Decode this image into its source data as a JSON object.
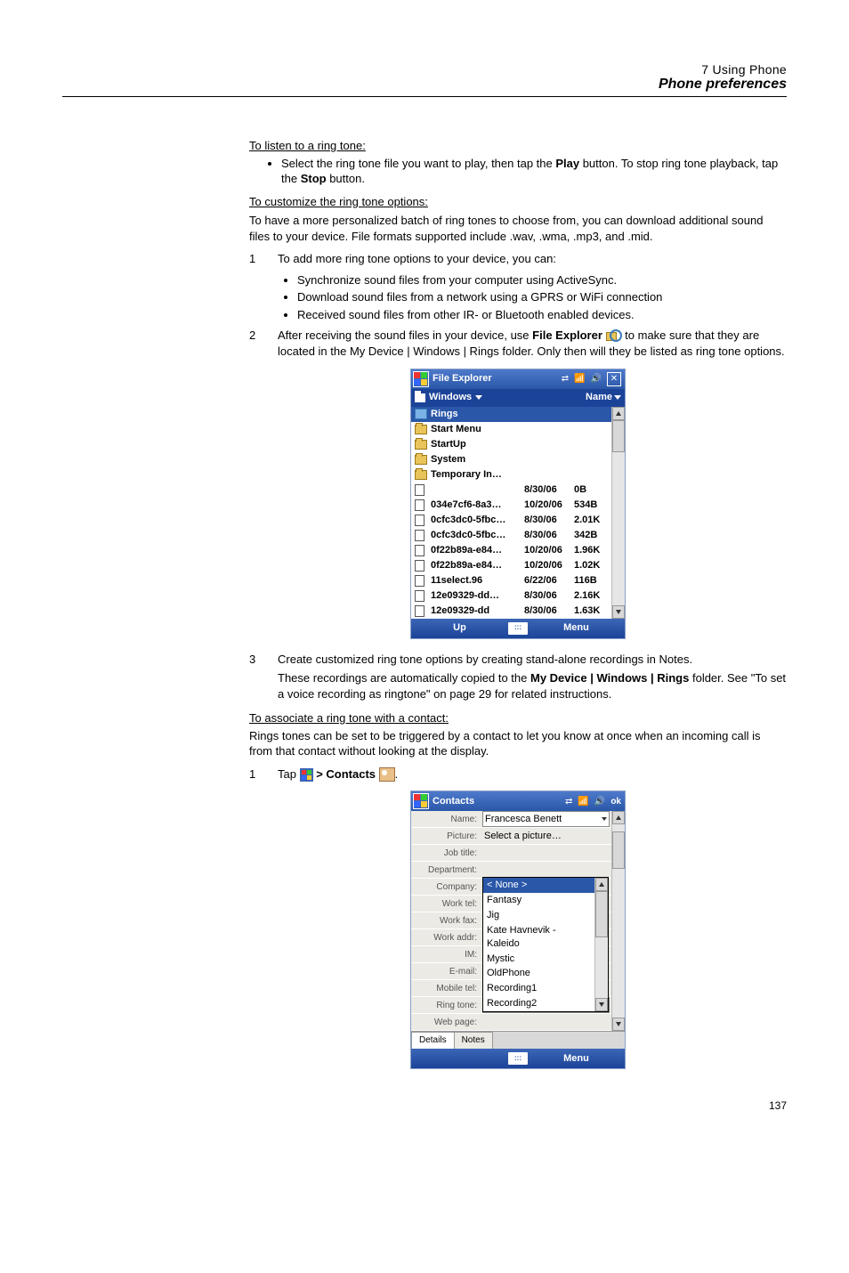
{
  "page_number": "137",
  "header": {
    "chapter": "7 Using Phone",
    "section": "Phone preferences"
  },
  "body": {
    "listen_heading": "To listen to a ring tone:",
    "listen_bullet": "Select the ring tone file you want to play, then tap the Play button. To stop ring tone playback, tap the Stop button.",
    "listen_bullet_plain_pre": "Select the ring tone file you want to play, then tap the ",
    "listen_bullet_bold1": "Play",
    "listen_bullet_mid": " button. To stop ring tone playback, tap the ",
    "listen_bullet_bold2": "Stop",
    "listen_bullet_post": " button.",
    "customize_heading": "To customize the ring tone options:",
    "customize_para": "To have a more personalized batch of ring tones to choose from, you can download additional sound files to your device. File formats supported include .wav, .wma, .mp3, and .mid.",
    "step1": {
      "num": "1",
      "text": "To add more ring tone options to your device, you can:"
    },
    "step1_bullets": [
      "Synchronize sound files from your computer using ActiveSync.",
      "Download sound files from a network using a GPRS or WiFi connection",
      "Received sound files from other IR- or Bluetooth enabled devices."
    ],
    "step2": {
      "num": "2",
      "pre": "After receiving the sound files in your device, use ",
      "bold": "File Explorer",
      "post": " to make sure that they are located in the My Device | Windows | Rings folder. Only then will they be listed as ring tone options."
    },
    "step3": {
      "num": "3",
      "line1": "Create customized ring tone options by creating stand-alone recordings in Notes.",
      "line2_pre": "These recordings are automatically copied to the ",
      "line2_bold": "My Device | Windows | Rings",
      "line2_post": " folder. See \"To set a voice recording as ringtone\" on page 29 for related instructions."
    },
    "assoc_heading": "To associate a ring tone with a contact:",
    "assoc_para": "Rings tones can be set to be triggered by a contact to let you know at once when an incoming call is from that contact without looking at the display.",
    "assoc_step1": {
      "num": "1",
      "pre": "Tap ",
      "bold": " > Contacts ",
      "post": "."
    }
  },
  "screenshot1": {
    "title": "File Explorer",
    "close": "✕",
    "subbar_left": "Windows",
    "subbar_right": "Name",
    "rows": [
      {
        "type": "rings",
        "name": "Rings",
        "date": "",
        "size": "",
        "sel": true
      },
      {
        "type": "folder",
        "name": "Start Menu",
        "date": "",
        "size": ""
      },
      {
        "type": "folder",
        "name": "StartUp",
        "date": "",
        "size": ""
      },
      {
        "type": "folder",
        "name": "System",
        "date": "",
        "size": ""
      },
      {
        "type": "folder",
        "name": "Temporary In…",
        "date": "",
        "size": ""
      },
      {
        "type": "file",
        "name": "",
        "date": "8/30/06",
        "size": "0B"
      },
      {
        "type": "file",
        "name": "034e7cf6-8a3…",
        "date": "10/20/06",
        "size": "534B"
      },
      {
        "type": "file",
        "name": "0cfc3dc0-5fbc…",
        "date": "8/30/06",
        "size": "2.01K"
      },
      {
        "type": "file",
        "name": "0cfc3dc0-5fbc…",
        "date": "8/30/06",
        "size": "342B"
      },
      {
        "type": "file",
        "name": "0f22b89a-e84…",
        "date": "10/20/06",
        "size": "1.96K"
      },
      {
        "type": "file",
        "name": "0f22b89a-e84…",
        "date": "10/20/06",
        "size": "1.02K"
      },
      {
        "type": "file",
        "name": "11select.96",
        "date": "6/22/06",
        "size": "116B"
      },
      {
        "type": "file",
        "name": "12e09329-dd…",
        "date": "8/30/06",
        "size": "2.16K"
      },
      {
        "type": "file",
        "name": "12e09329-dd",
        "date": "8/30/06",
        "size": "1.63K"
      }
    ],
    "soft_left": "Up",
    "soft_right": "Menu",
    "kbd": ":::"
  },
  "screenshot2": {
    "title": "Contacts",
    "ok": "ok",
    "fields": {
      "name_label": "Name:",
      "name_value": "Francesca Benett",
      "picture_label": "Picture:",
      "picture_value": "Select a picture…",
      "jobtitle_label": "Job title:",
      "jobtitle_value": "",
      "dept_label": "Department:",
      "dept_value": "",
      "company_label": "Company:",
      "company_value": "",
      "worktel_label": "Work tel:",
      "worktel_value": "",
      "workfax_label": "Work fax:",
      "workfax_value": "",
      "workaddr_label": "Work addr:",
      "workaddr_value": "",
      "im_label": "IM:",
      "im_value": "",
      "email_label": "E-mail:",
      "email_value": "",
      "mobiletel_label": "Mobile tel:",
      "mobiletel_value": "",
      "ringtone_label": "Ring tone:",
      "ringtone_value": "< None >",
      "webpage_label": "Web page:",
      "webpage_value": ""
    },
    "dropdown": {
      "items": [
        {
          "text": "< None >",
          "sel": true
        },
        {
          "text": "Fantasy"
        },
        {
          "text": "Jig"
        },
        {
          "text": "Kate Havnevik - Kaleido"
        },
        {
          "text": "Mystic"
        },
        {
          "text": "OldPhone"
        },
        {
          "text": "Recording1"
        },
        {
          "text": "Recording2"
        }
      ]
    },
    "tabs": {
      "details": "Details",
      "notes": "Notes"
    },
    "soft_right": "Menu",
    "kbd": ":::"
  }
}
